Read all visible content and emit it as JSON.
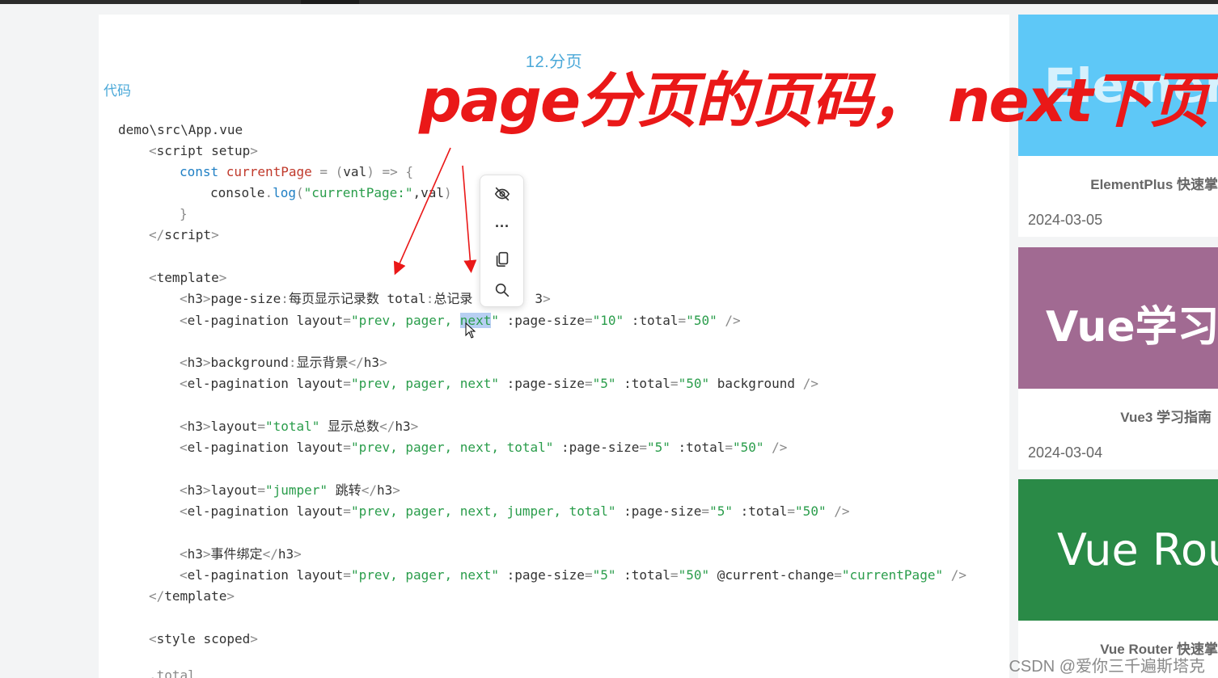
{
  "doc": {
    "title": "12.分页",
    "section_label": "代码"
  },
  "code_lines": [
    [
      {
        "t": "demo\\src\\App.vue"
      }
    ],
    [
      {
        "t": "<",
        "c": "punct"
      },
      {
        "t": "script setup"
      },
      {
        "t": ">",
        "c": "punct"
      }
    ],
    [
      {
        "t": "const ",
        "c": "kw"
      },
      {
        "t": "currentPage",
        "c": "var"
      },
      {
        "t": " = (",
        "c": "punct"
      },
      {
        "t": "val"
      },
      {
        "t": ") => {",
        "c": "punct"
      }
    ],
    [
      {
        "t": "console"
      },
      {
        "t": ".",
        "c": "punct"
      },
      {
        "t": "log",
        "c": "fn"
      },
      {
        "t": "(",
        "c": "punct"
      },
      {
        "t": "\"currentPage:\"",
        "c": "str"
      },
      {
        "t": ","
      },
      {
        "t": "val"
      },
      {
        "t": ")",
        "c": "punct"
      }
    ],
    [
      {
        "t": "}",
        "c": "punct"
      }
    ],
    [
      {
        "t": "</",
        "c": "punct"
      },
      {
        "t": "script"
      },
      {
        "t": ">",
        "c": "punct"
      }
    ],
    [
      {
        "t": "<",
        "c": "punct"
      },
      {
        "t": "template"
      },
      {
        "t": ">",
        "c": "punct"
      }
    ],
    [
      {
        "t": "<",
        "c": "punct"
      },
      {
        "t": "h3"
      },
      {
        "t": ">",
        "c": "punct"
      },
      {
        "t": "page-size"
      },
      {
        "t": ":",
        "c": "punct"
      },
      {
        "t": "每页显示记录数 total"
      },
      {
        "t": ":",
        "c": "punct"
      },
      {
        "t": "总记录"
      },
      {
        "t": "        "
      },
      {
        "t": "3"
      },
      {
        "t": ">",
        "c": "punct"
      }
    ],
    [
      {
        "t": "<",
        "c": "punct"
      },
      {
        "t": "el-pagination layout"
      },
      {
        "t": "=",
        "c": "punct"
      },
      {
        "t": "\"prev, pager, ",
        "c": "str"
      },
      {
        "t": "next",
        "c": "str sel"
      },
      {
        "t": "\"",
        "c": "str"
      },
      {
        "t": " :page-size"
      },
      {
        "t": "=",
        "c": "punct"
      },
      {
        "t": "\"10\"",
        "c": "str"
      },
      {
        "t": " :total"
      },
      {
        "t": "=",
        "c": "punct"
      },
      {
        "t": "\"50\"",
        "c": "str"
      },
      {
        "t": " />",
        "c": "punct"
      }
    ],
    [
      {
        "t": "<",
        "c": "punct"
      },
      {
        "t": "h3"
      },
      {
        "t": ">",
        "c": "punct"
      },
      {
        "t": "background"
      },
      {
        "t": ":",
        "c": "punct"
      },
      {
        "t": "显示背景"
      },
      {
        "t": "</",
        "c": "punct"
      },
      {
        "t": "h3"
      },
      {
        "t": ">",
        "c": "punct"
      }
    ],
    [
      {
        "t": "<",
        "c": "punct"
      },
      {
        "t": "el-pagination layout"
      },
      {
        "t": "=",
        "c": "punct"
      },
      {
        "t": "\"prev, pager, next\"",
        "c": "str"
      },
      {
        "t": " :page-size"
      },
      {
        "t": "=",
        "c": "punct"
      },
      {
        "t": "\"5\"",
        "c": "str"
      },
      {
        "t": " :total"
      },
      {
        "t": "=",
        "c": "punct"
      },
      {
        "t": "\"50\"",
        "c": "str"
      },
      {
        "t": " background "
      },
      {
        "t": "/>",
        "c": "punct"
      }
    ],
    [
      {
        "t": "<",
        "c": "punct"
      },
      {
        "t": "h3"
      },
      {
        "t": ">",
        "c": "punct"
      },
      {
        "t": "layout"
      },
      {
        "t": "=",
        "c": "punct"
      },
      {
        "t": "\"total\"",
        "c": "str"
      },
      {
        "t": " 显示总数"
      },
      {
        "t": "</",
        "c": "punct"
      },
      {
        "t": "h3"
      },
      {
        "t": ">",
        "c": "punct"
      }
    ],
    [
      {
        "t": "<",
        "c": "punct"
      },
      {
        "t": "el-pagination layout"
      },
      {
        "t": "=",
        "c": "punct"
      },
      {
        "t": "\"prev, pager, next, total\"",
        "c": "str"
      },
      {
        "t": " :page-size"
      },
      {
        "t": "=",
        "c": "punct"
      },
      {
        "t": "\"5\"",
        "c": "str"
      },
      {
        "t": " :total"
      },
      {
        "t": "=",
        "c": "punct"
      },
      {
        "t": "\"50\"",
        "c": "str"
      },
      {
        "t": " />",
        "c": "punct"
      }
    ],
    [
      {
        "t": "<",
        "c": "punct"
      },
      {
        "t": "h3"
      },
      {
        "t": ">",
        "c": "punct"
      },
      {
        "t": "layout"
      },
      {
        "t": "=",
        "c": "punct"
      },
      {
        "t": "\"jumper\"",
        "c": "str"
      },
      {
        "t": " 跳转"
      },
      {
        "t": "</",
        "c": "punct"
      },
      {
        "t": "h3"
      },
      {
        "t": ">",
        "c": "punct"
      }
    ],
    [
      {
        "t": "<",
        "c": "punct"
      },
      {
        "t": "el-pagination layout"
      },
      {
        "t": "=",
        "c": "punct"
      },
      {
        "t": "\"prev, pager, next, jumper, total\"",
        "c": "str"
      },
      {
        "t": " :page-size"
      },
      {
        "t": "=",
        "c": "punct"
      },
      {
        "t": "\"5\"",
        "c": "str"
      },
      {
        "t": " :total"
      },
      {
        "t": "=",
        "c": "punct"
      },
      {
        "t": "\"50\"",
        "c": "str"
      },
      {
        "t": " />",
        "c": "punct"
      }
    ],
    [
      {
        "t": "<",
        "c": "punct"
      },
      {
        "t": "h3"
      },
      {
        "t": ">",
        "c": "punct"
      },
      {
        "t": "事件绑定"
      },
      {
        "t": "</",
        "c": "punct"
      },
      {
        "t": "h3"
      },
      {
        "t": ">",
        "c": "punct"
      }
    ],
    [
      {
        "t": "<",
        "c": "punct"
      },
      {
        "t": "el-pagination layout"
      },
      {
        "t": "=",
        "c": "punct"
      },
      {
        "t": "\"prev, pager, next\"",
        "c": "str"
      },
      {
        "t": " :page-size"
      },
      {
        "t": "=",
        "c": "punct"
      },
      {
        "t": "\"5\"",
        "c": "str"
      },
      {
        "t": " :total"
      },
      {
        "t": "=",
        "c": "punct"
      },
      {
        "t": "\"50\"",
        "c": "str"
      },
      {
        "t": " @current-change"
      },
      {
        "t": "=",
        "c": "punct"
      },
      {
        "t": "\"currentPage\"",
        "c": "str"
      },
      {
        "t": " />",
        "c": "punct"
      }
    ],
    [
      {
        "t": "</",
        "c": "punct"
      },
      {
        "t": "template"
      },
      {
        "t": ">",
        "c": "punct"
      }
    ],
    [
      {
        "t": "<",
        "c": "punct"
      },
      {
        "t": "style scoped"
      },
      {
        "t": ">",
        "c": "punct"
      }
    ],
    [
      {
        "t": ".total",
        "c": "punct"
      }
    ]
  ],
  "annotation": {
    "text": "page分页的页码， next下页",
    "color": "#ea1818"
  },
  "context_menu": {
    "items": [
      {
        "icon": "eye-off-icon"
      },
      {
        "icon": "more-icon",
        "glyph": "···"
      },
      {
        "icon": "copy-icon"
      },
      {
        "icon": "search-icon"
      }
    ]
  },
  "sidebar": {
    "cards": [
      {
        "banner_text": "ElementP",
        "banner_color": "#5ec8f7",
        "title": "ElementPlus 快速掌",
        "date": "2024-03-05"
      },
      {
        "banner_text": "Vue学习指",
        "banner_color": "#a16a92",
        "title": "Vue3 学习指南",
        "date": "2024-03-04"
      },
      {
        "banner_text": "Vue Rout",
        "banner_color": "#2a8a47",
        "title": "Vue Router 快速掌",
        "date": ""
      }
    ]
  },
  "watermark": "CSDN @爱你三千遍斯塔克"
}
